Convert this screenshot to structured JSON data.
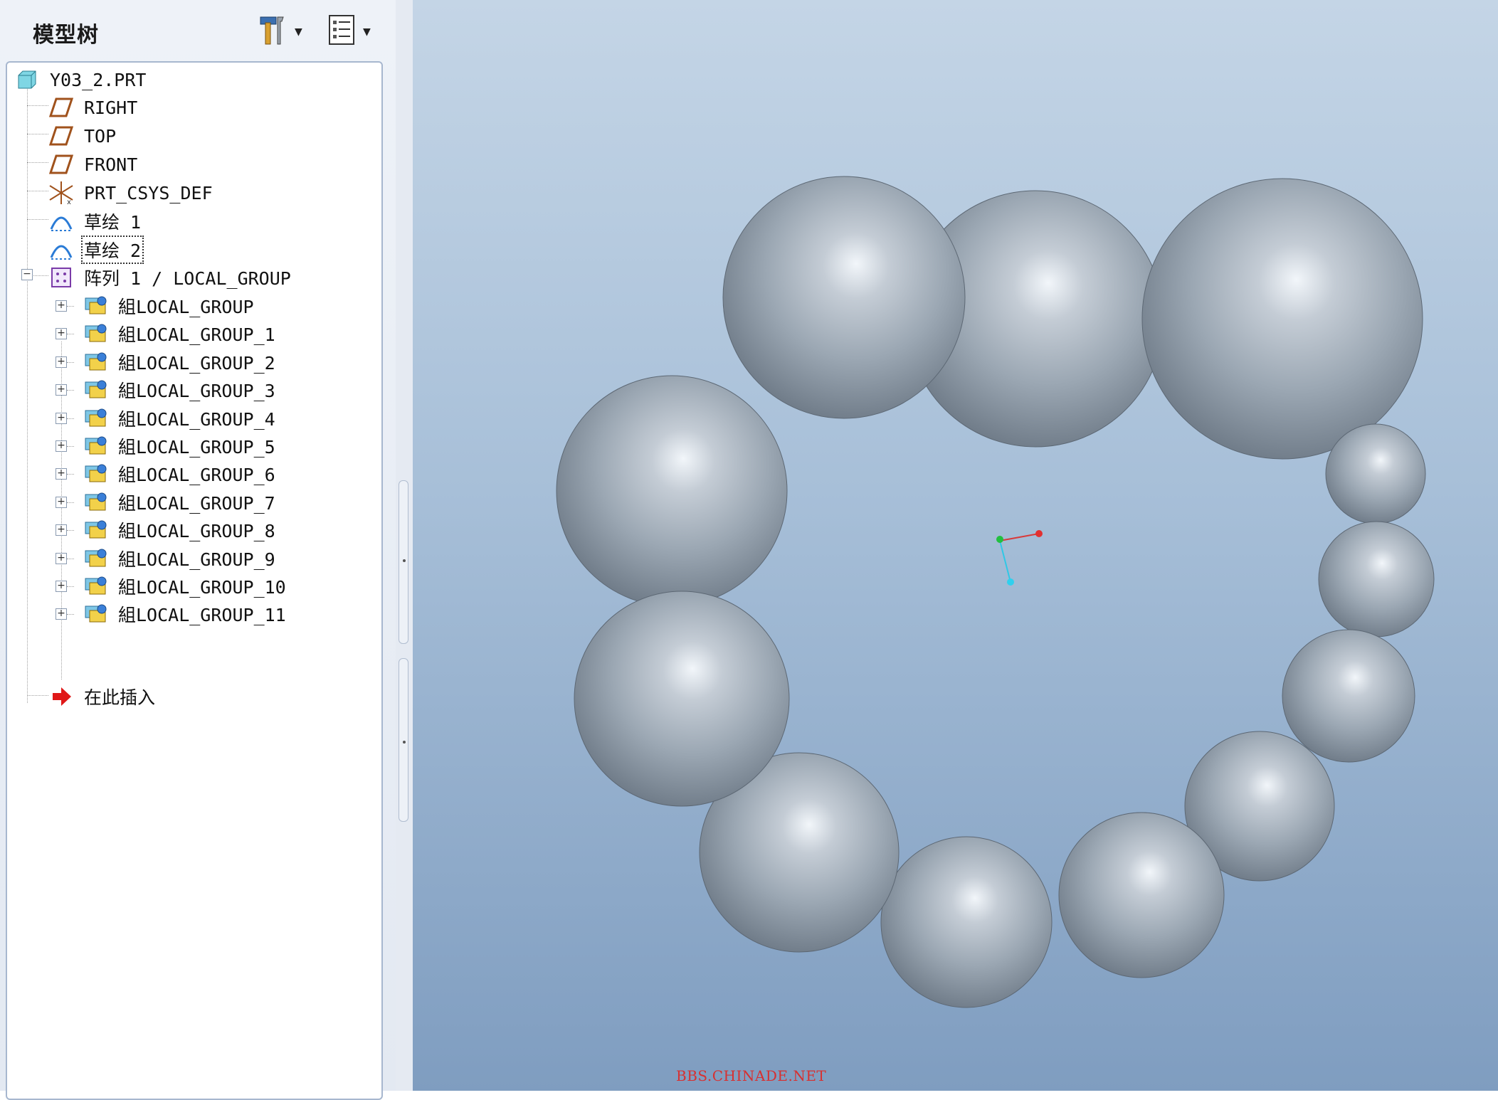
{
  "panel": {
    "title": "模型树",
    "settings_icon": "tools-icon",
    "show_icon": "list-view-icon"
  },
  "tree": {
    "root": "Y03_2.PRT",
    "datums": [
      "RIGHT",
      "TOP",
      "FRONT"
    ],
    "csys": "PRT_CSYS_DEF",
    "sketches": [
      "草绘 1",
      "草绘 2"
    ],
    "pattern": "阵列 1 / LOCAL_GROUP",
    "groups": [
      "組LOCAL_GROUP",
      "組LOCAL_GROUP_1",
      "組LOCAL_GROUP_2",
      "組LOCAL_GROUP_3",
      "組LOCAL_GROUP_4",
      "組LOCAL_GROUP_5",
      "組LOCAL_GROUP_6",
      "組LOCAL_GROUP_7",
      "組LOCAL_GROUP_8",
      "組LOCAL_GROUP_9",
      "組LOCAL_GROUP_10",
      "組LOCAL_GROUP_11"
    ],
    "insert_here": "在此插入"
  },
  "viewport": {
    "watermark": "BBS.CHINADE.NET",
    "sphere_count": 12,
    "colors": {
      "background_top": "#c4d5e6",
      "background_bottom": "#7f9dc0",
      "sphere": "#9aa6b2"
    }
  }
}
